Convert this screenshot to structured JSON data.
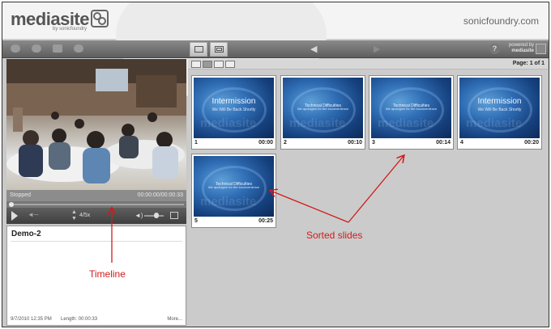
{
  "header": {
    "logo_text": "mediasite",
    "logo_sub": "by sonicfoundry",
    "brand_url": "sonicfoundry.com"
  },
  "toolbar": {
    "powered_line1": "powered by",
    "powered_line2": "mediasite",
    "help_label": "?"
  },
  "player": {
    "status": "Stopped",
    "time": "00:00:00/00:00:33",
    "speed": "4/5x",
    "progress_fraction": 0.0
  },
  "presentation": {
    "title": "Demo-2",
    "date": "9/7/2010 12:35 PM",
    "length": "Length: 00:00:33",
    "more": "More..."
  },
  "slides_panel": {
    "page_label": "Page: 1 of 1",
    "slides": [
      {
        "number": "1",
        "time": "00:00",
        "line1": "Intermission",
        "line2": "We Will Be Back Shortly",
        "style": "intermission"
      },
      {
        "number": "2",
        "time": "00:10",
        "line1": "Technical Difficulties",
        "line2": "We apologize for the inconvenience",
        "style": "technical"
      },
      {
        "number": "3",
        "time": "00:14",
        "line1": "Technical Difficulties",
        "line2": "We apologize for the inconvenience",
        "style": "technical"
      },
      {
        "number": "4",
        "time": "00:20",
        "line1": "Intermission",
        "line2": "We Will Be Back Shortly",
        "style": "intermission"
      },
      {
        "number": "5",
        "time": "00:25",
        "line1": "Technical Difficulties",
        "line2": "We apologize for the inconvenience",
        "style": "technical"
      }
    ],
    "watermark": "mediasite"
  },
  "annotations": {
    "timeline_label": "Timeline",
    "sorted_label": "Sorted slides",
    "color": "#d11b1b"
  }
}
